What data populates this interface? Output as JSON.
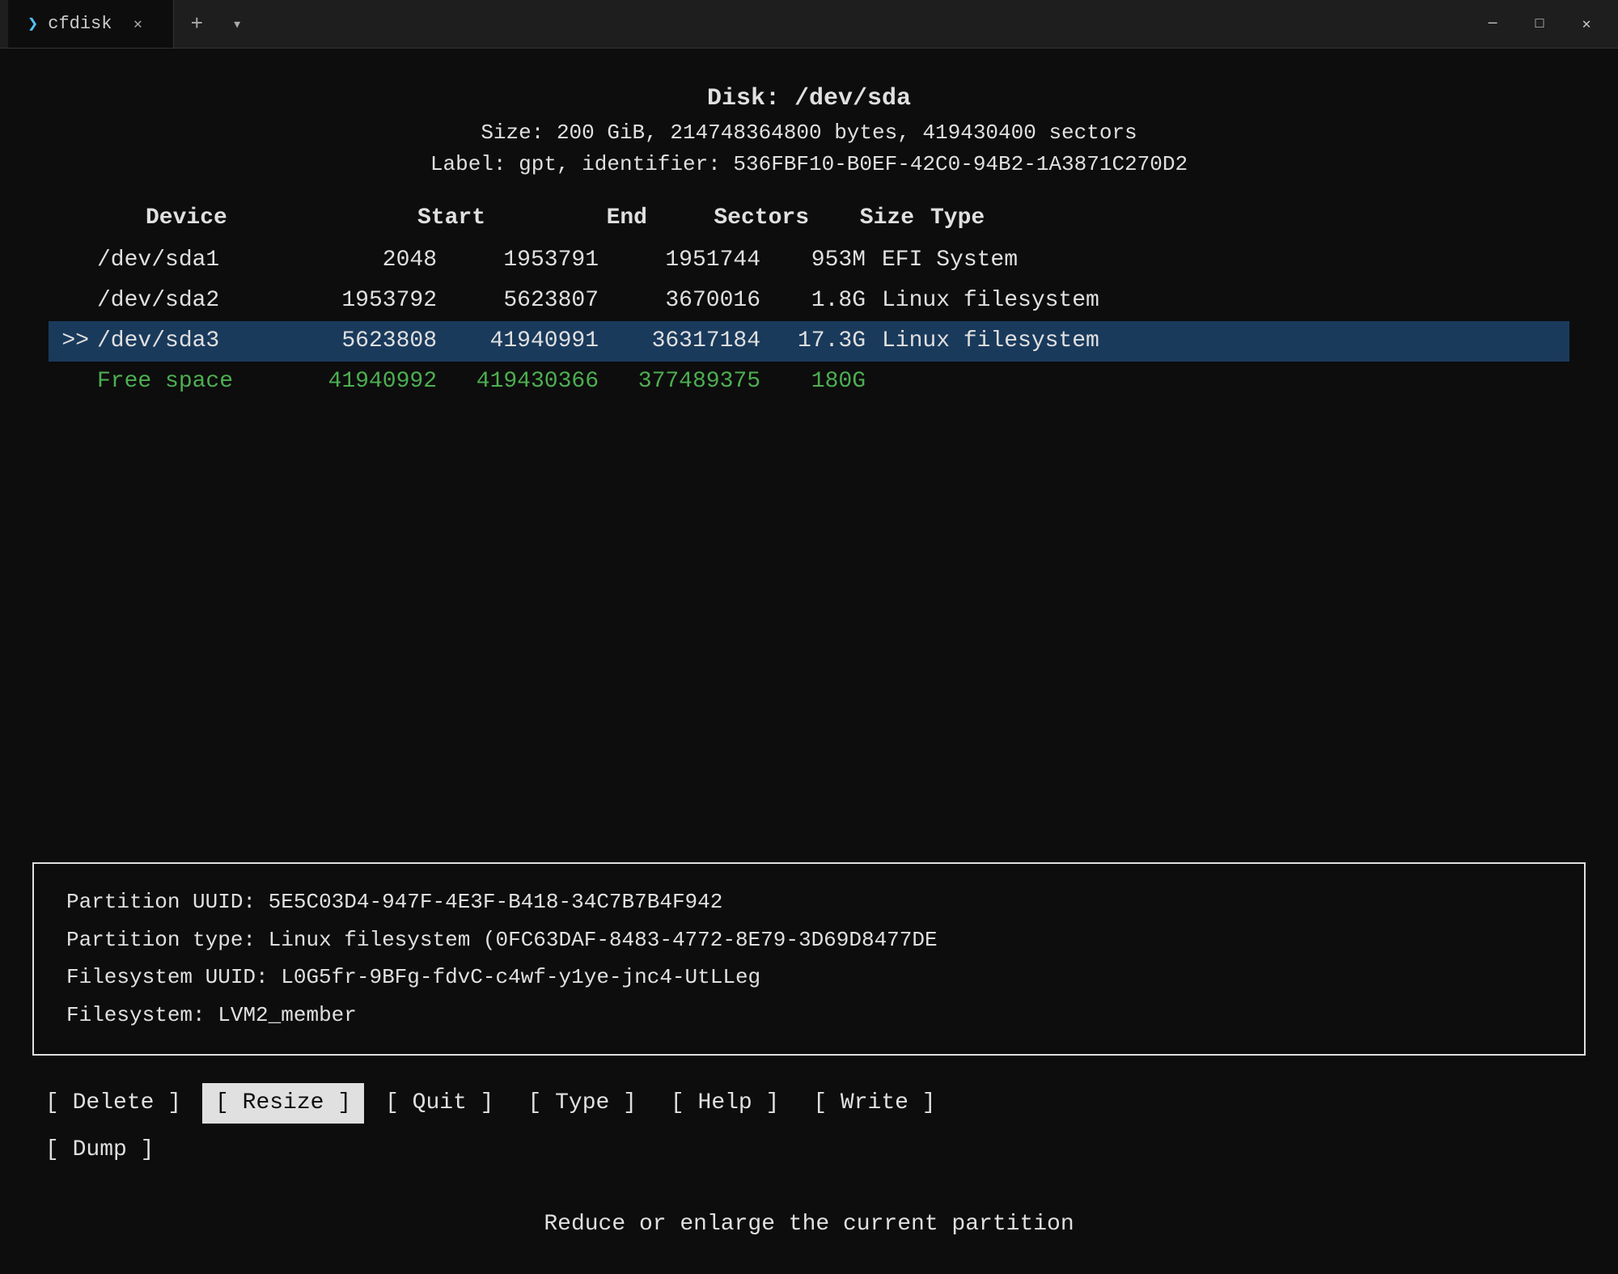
{
  "titlebar": {
    "tab_icon": "❯",
    "tab_title": "cfdisk",
    "close_btn": "✕",
    "new_tab_btn": "+",
    "dropdown_btn": "▾",
    "minimize_btn": "─",
    "maximize_btn": "□",
    "winclose_btn": "✕"
  },
  "disk": {
    "title": "Disk: /dev/sda",
    "size_line": "Size: 200 GiB, 214748364800 bytes, 419430400 sectors",
    "label_line": "Label: gpt, identifier: 536FBF10-B0EF-42C0-94B2-1A3871C270D2"
  },
  "table": {
    "headers": {
      "device": "Device",
      "start": "Start",
      "end": "End",
      "sectors": "Sectors",
      "size": "Size",
      "type": "Type"
    },
    "rows": [
      {
        "selected": false,
        "free": false,
        "selector": "",
        "device": "/dev/sda1",
        "start": "2048",
        "end": "1953791",
        "sectors": "1951744",
        "size": "953M",
        "type": "EFI System"
      },
      {
        "selected": false,
        "free": false,
        "selector": "",
        "device": "/dev/sda2",
        "start": "1953792",
        "end": "5623807",
        "sectors": "3670016",
        "size": "1.8G",
        "type": "Linux filesystem"
      },
      {
        "selected": true,
        "free": false,
        "selector": ">>",
        "device": "/dev/sda3",
        "start": "5623808",
        "end": "41940991",
        "sectors": "36317184",
        "size": "17.3G",
        "type": "Linux filesystem"
      },
      {
        "selected": false,
        "free": true,
        "selector": "",
        "device": "Free space",
        "start": "41940992",
        "end": "419430366",
        "sectors": "377489375",
        "size": "180G",
        "type": ""
      }
    ]
  },
  "info_box": {
    "line1_label": "Partition UUID:",
    "line1_value": "5E5C03D4-947F-4E3F-B418-34C7B7B4F942",
    "line2_label": "Partition type:",
    "line2_value": "Linux filesystem (0FC63DAF-8483-4772-8E79-3D69D8477DE",
    "line3_label": "Filesystem UUID:",
    "line3_value": "L0G5fr-9BFg-fdvC-c4wf-y1ye-jnc4-UtLLeg",
    "line4_label": "Filesystem:",
    "line4_value": "LVM2_member"
  },
  "actions": {
    "row1": [
      {
        "label": "[ Delete ]",
        "selected": false
      },
      {
        "label": "[ Resize ]",
        "selected": true
      },
      {
        "label": "[ Quit ]",
        "selected": false
      },
      {
        "label": "[ Type ]",
        "selected": false
      },
      {
        "label": "[ Help ]",
        "selected": false
      },
      {
        "label": "[ Write ]",
        "selected": false
      }
    ],
    "row2": [
      {
        "label": "[ Dump ]",
        "selected": false
      }
    ]
  },
  "status": {
    "text": "Reduce or enlarge the current partition"
  }
}
